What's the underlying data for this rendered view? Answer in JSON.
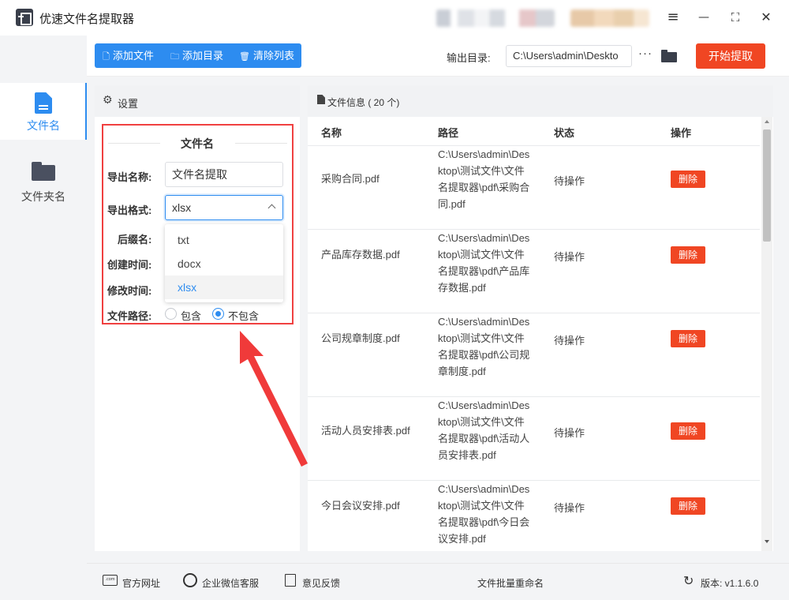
{
  "app": {
    "title": "优速文件名提取器",
    "window_controls": {
      "menu": "≡",
      "minimize": "—",
      "maximize": "⛶",
      "close": "✕"
    }
  },
  "sidebar": {
    "items": [
      {
        "label": "文件名",
        "icon": "document-icon",
        "active": true
      },
      {
        "label": "文件夹名",
        "icon": "folder-icon",
        "active": false
      }
    ]
  },
  "toolbar": {
    "add_file": "添加文件",
    "add_dir": "添加目录",
    "clear_list": "清除列表",
    "output_label": "输出目录:",
    "output_value": "C:\\Users\\admin\\Deskto",
    "more": "···",
    "start": "开始提取"
  },
  "settings": {
    "header": "设置",
    "section_title": "文件名",
    "export_name_label": "导出名称:",
    "export_name_value": "文件名提取",
    "export_format_label": "导出格式:",
    "export_format_value": "xlsx",
    "format_options": [
      "txt",
      "docx",
      "xlsx"
    ],
    "selected_format": "xlsx",
    "suffix_label": "后缀名:",
    "created_label": "创建时间:",
    "modified_label": "修改时间:",
    "path_label": "文件路径:",
    "path_options": [
      "包含",
      "不包含"
    ],
    "path_selected": "不包含"
  },
  "files": {
    "header": "文件信息 ( 20 个)",
    "columns": [
      "名称",
      "路径",
      "状态",
      "操作"
    ],
    "rows": [
      {
        "name": "采购合同.pdf",
        "path": "C:\\Users\\admin\\Desktop\\测试文件\\文件名提取器\\pdf\\采购合同.pdf",
        "status": "待操作",
        "action": "删除"
      },
      {
        "name": "产品库存数据.pdf",
        "path": "C:\\Users\\admin\\Desktop\\测试文件\\文件名提取器\\pdf\\产品库存数据.pdf",
        "status": "待操作",
        "action": "删除"
      },
      {
        "name": "公司规章制度.pdf",
        "path": "C:\\Users\\admin\\Desktop\\测试文件\\文件名提取器\\pdf\\公司规章制度.pdf",
        "status": "待操作",
        "action": "删除"
      },
      {
        "name": "活动人员安排表.pdf",
        "path": "C:\\Users\\admin\\Desktop\\测试文件\\文件名提取器\\pdf\\活动人员安排表.pdf",
        "status": "待操作",
        "action": "删除"
      },
      {
        "name": "今日会议安排.pdf",
        "path": "C:\\Users\\admin\\Desktop\\测试文件\\文件名提取器\\pdf\\今日会议安排.pdf",
        "status": "待操作",
        "action": "删除"
      }
    ]
  },
  "footer": {
    "website": "官方网址",
    "wechat": "企业微信客服",
    "feedback": "意见反馈",
    "center": "文件批量重命名",
    "version": "版本: v1.1.6.0",
    "web_icon_text": ".com"
  }
}
